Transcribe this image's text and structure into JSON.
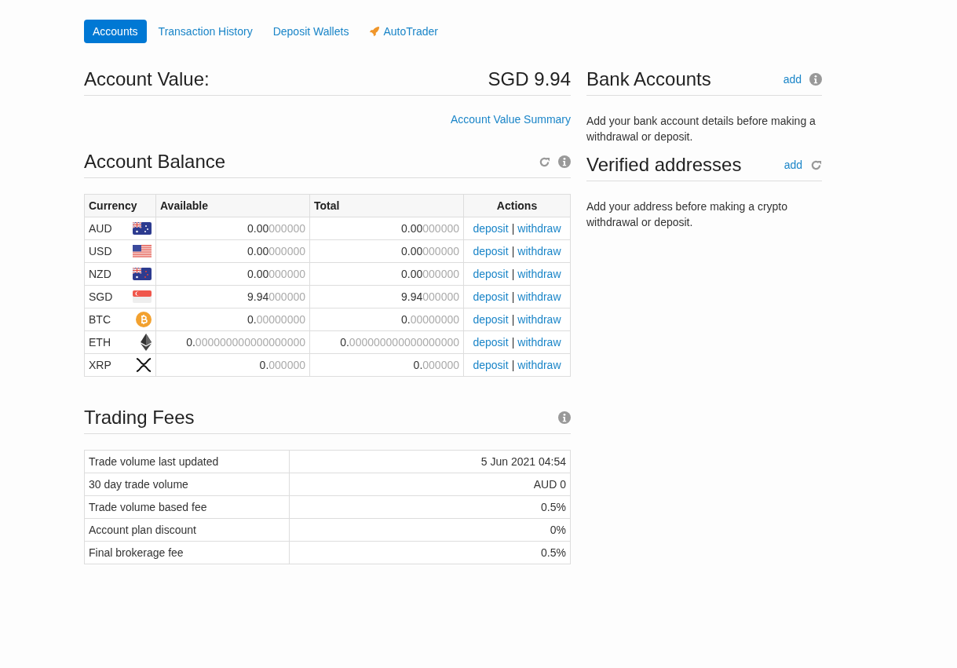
{
  "tabs": [
    {
      "label": "Accounts",
      "selected": true,
      "kind": "plain"
    },
    {
      "label": "Transaction History",
      "selected": false,
      "kind": "plain"
    },
    {
      "label": "Deposit Wallets",
      "selected": false,
      "kind": "plain"
    },
    {
      "label": "AutoTrader",
      "selected": false,
      "kind": "rocket"
    }
  ],
  "account_value": {
    "title": "Account Value:",
    "value": "SGD 9.94",
    "summary_link": "Account Value Summary"
  },
  "account_balance": {
    "title": "Account Balance",
    "columns": [
      "Currency",
      "Available",
      "Total",
      "Actions"
    ],
    "rows": [
      {
        "currency": "AUD",
        "kind": "au",
        "available": {
          "main": "0.00",
          "faded": "000000"
        },
        "total": {
          "main": "0.00",
          "faded": "000000"
        },
        "deposit": "deposit",
        "separator": "|",
        "withdraw": "withdraw"
      },
      {
        "currency": "USD",
        "kind": "us",
        "available": {
          "main": "0.00",
          "faded": "000000"
        },
        "total": {
          "main": "0.00",
          "faded": "000000"
        },
        "deposit": "deposit",
        "separator": "|",
        "withdraw": "withdraw"
      },
      {
        "currency": "NZD",
        "kind": "nz",
        "available": {
          "main": "0.00",
          "faded": "000000"
        },
        "total": {
          "main": "0.00",
          "faded": "000000"
        },
        "deposit": "deposit",
        "separator": "|",
        "withdraw": "withdraw"
      },
      {
        "currency": "SGD",
        "kind": "sg",
        "available": {
          "main": "9.94",
          "faded": "000000"
        },
        "total": {
          "main": "9.94",
          "faded": "000000"
        },
        "deposit": "deposit",
        "separator": "|",
        "withdraw": "withdraw"
      },
      {
        "currency": "BTC",
        "kind": "btc",
        "available": {
          "main": "0.",
          "faded": "00000000"
        },
        "total": {
          "main": "0.",
          "faded": "00000000"
        },
        "deposit": "deposit",
        "separator": "|",
        "withdraw": "withdraw"
      },
      {
        "currency": "ETH",
        "kind": "eth",
        "available": {
          "main": "0.",
          "faded": "000000000000000000"
        },
        "total": {
          "main": "0.",
          "faded": "000000000000000000"
        },
        "deposit": "deposit",
        "separator": "|",
        "withdraw": "withdraw"
      },
      {
        "currency": "XRP",
        "kind": "xrp",
        "available": {
          "main": "0.",
          "faded": "000000"
        },
        "total": {
          "main": "0.",
          "faded": "000000"
        },
        "deposit": "deposit",
        "separator": "|",
        "withdraw": "withdraw"
      }
    ]
  },
  "trading_fees": {
    "title": "Trading Fees",
    "rows": [
      {
        "label": "Trade volume last updated",
        "value": "5 Jun 2021 04:54"
      },
      {
        "label": "30 day trade volume",
        "value": "AUD 0"
      },
      {
        "label": "Trade volume based fee",
        "value": "0.5%"
      },
      {
        "label": "Account plan discount",
        "value": "0%"
      },
      {
        "label": "Final brokerage fee",
        "value": "0.5%"
      }
    ]
  },
  "bank_accounts": {
    "title": "Bank Accounts",
    "action": "add",
    "text": "Add your bank account details before making a withdrawal or deposit."
  },
  "verified_addresses": {
    "title": "Verified addresses",
    "action": "add",
    "text": "Add your address before making a crypto withdrawal or deposit."
  }
}
